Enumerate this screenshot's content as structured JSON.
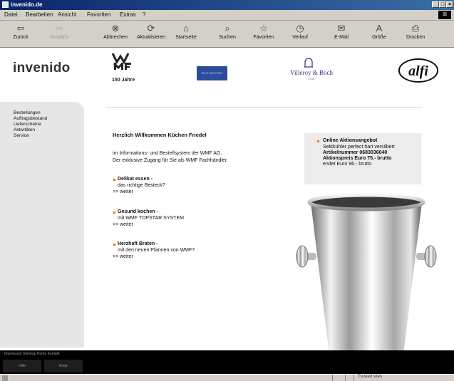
{
  "window": {
    "title": "invenido.de",
    "controls": [
      "_",
      "□",
      "×"
    ]
  },
  "menu": [
    "Datei",
    "Bearbeiten",
    "Ansicht",
    "Favoriten",
    "Extras",
    "?"
  ],
  "toolbar": [
    {
      "label": "Zurück",
      "icon": "back-arrow-icon",
      "glyph": "⇦",
      "enabled": true
    },
    {
      "label": "Vorwärts",
      "icon": "forward-arrow-icon",
      "glyph": "⇨",
      "enabled": false
    },
    {
      "label": "Abbrechen",
      "icon": "stop-icon",
      "glyph": "⊗",
      "enabled": true
    },
    {
      "label": "Aktualisieren",
      "icon": "refresh-icon",
      "glyph": "⟳",
      "enabled": true
    },
    {
      "label": "Startseite",
      "icon": "home-icon",
      "glyph": "⌂",
      "enabled": true
    },
    {
      "label": "Suchen",
      "icon": "search-icon",
      "glyph": "⌕",
      "enabled": true
    },
    {
      "label": "Favoriten",
      "icon": "favorites-icon",
      "glyph": "☆",
      "enabled": true
    },
    {
      "label": "Verlauf",
      "icon": "history-icon",
      "glyph": "◷",
      "enabled": true
    },
    {
      "label": "E-Mail",
      "icon": "mail-icon",
      "glyph": "✉",
      "enabled": true
    },
    {
      "label": "Größe",
      "icon": "font-size-icon",
      "glyph": "A",
      "enabled": true
    },
    {
      "label": "Drucken",
      "icon": "print-icon",
      "glyph": "⎙",
      "enabled": true
    }
  ],
  "header": {
    "logo_text": "invenido",
    "wmf_subtitle": "150 Jahre",
    "partner_logo_text": "SILIT ELECTRO",
    "villeroy_boch": "Villeroy & Boch",
    "villeroy_boch_sub": "1748",
    "alfi": "alfi"
  },
  "sidebar": {
    "items": [
      "Bestellungen",
      "Auftragsbestand",
      "Lieferscheine",
      "Aktivitäten",
      "Service"
    ]
  },
  "main": {
    "greeting": "Herzlich Willkommen Küchen Friedel",
    "intro_line1": "im Informations- und Bestellsystem der WMF AG.",
    "intro_line2": "Der exklusive Zugang für Sie als WMF Fachhändler.",
    "features": [
      {
        "title": "Delikat essen -",
        "subtitle": "das richtige Besteck?",
        "link": ">> weiter"
      },
      {
        "title": "Gesund kochen -",
        "subtitle": "mit WMF TOPSTAR SYSTEM",
        "link": ">> weiter"
      },
      {
        "title": "Herzhaft Braten -",
        "subtitle": "mit den neuen Pfannen von WMF?",
        "link": ">> weiter"
      }
    ]
  },
  "offer": {
    "title": "Online Aktionsangebot",
    "line1": "Sektkühler perfect hart versilbert",
    "line2": "Artikelnummer 0683036040",
    "line3": "Aktionspreis Euro 75.- brutto",
    "line4": "endet Euro 96.- brutto"
  },
  "footer": {
    "links": "Impressum  Sitemap  Home  Kontakt",
    "buttons": [
      "Hilfe",
      "Ende"
    ]
  },
  "status": {
    "zone": "Trusted sites"
  },
  "colors": {
    "accent": "#e87a1a",
    "titlebar": "#0a246a"
  }
}
